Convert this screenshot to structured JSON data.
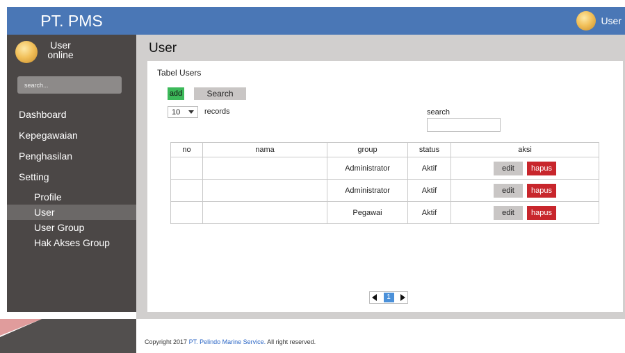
{
  "brand": {
    "title": "PT. PMS"
  },
  "sidebar": {
    "user_name": "User",
    "user_status": "online",
    "search_placeholder": "search...",
    "nav": [
      {
        "label": "Dashboard"
      },
      {
        "label": "Kepegawaian"
      },
      {
        "label": "Penghasilan"
      },
      {
        "label": "Setting"
      }
    ],
    "sub": [
      {
        "label": "Profile"
      },
      {
        "label": "User",
        "active": true
      },
      {
        "label": "User Group"
      },
      {
        "label": "Hak Akses Group"
      }
    ]
  },
  "header": {
    "user_label": "User"
  },
  "page": {
    "title": "User"
  },
  "panel": {
    "table_title": "Tabel Users",
    "add_label": "add",
    "search_button_label": "Search",
    "records_value": "10",
    "records_label": "records",
    "search_label": "search",
    "search_value": ""
  },
  "table": {
    "headers": [
      "no",
      "nama",
      "group",
      "status",
      "aksi"
    ],
    "rows": [
      {
        "no": "",
        "nama": "",
        "group": "Administrator",
        "status": "Aktif"
      },
      {
        "no": "",
        "nama": "",
        "group": "Administrator",
        "status": "Aktif"
      },
      {
        "no": "",
        "nama": "",
        "group": "Pegawai",
        "status": "Aktif"
      }
    ],
    "edit_label": "edit",
    "delete_label": "hapus"
  },
  "pagination": {
    "current": "1"
  },
  "footer": {
    "prefix": "Copyright 2017",
    "company": "PT. Pelindo Marine Service.",
    "suffix": "All right reserved."
  },
  "colors": {
    "primary": "#4a77b6",
    "sidebar": "#4b4746",
    "add": "#3cb95a",
    "delete": "#c8262c"
  }
}
